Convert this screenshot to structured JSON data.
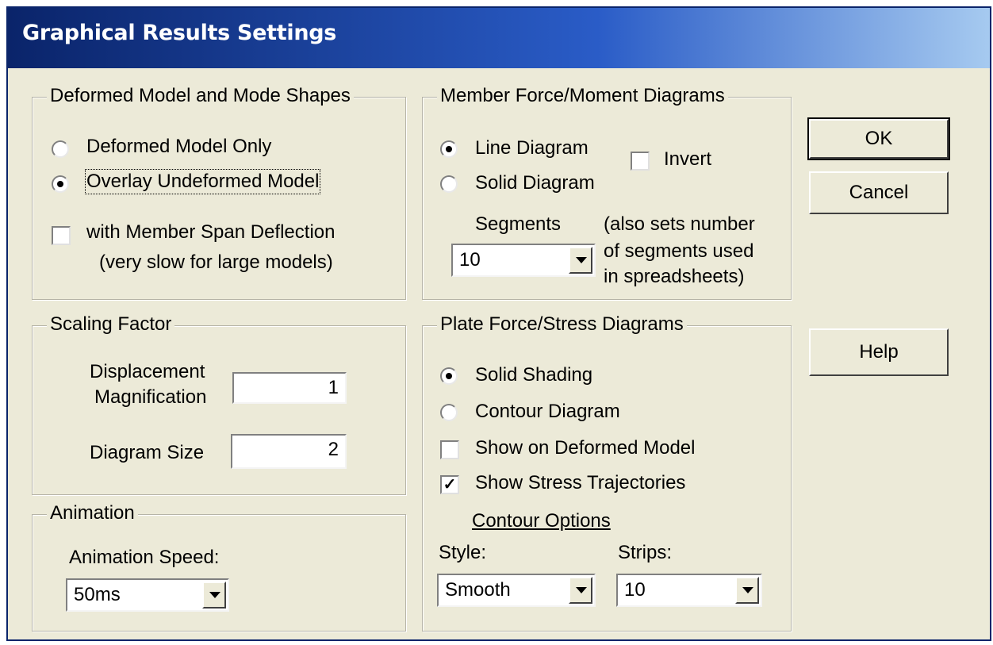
{
  "window": {
    "title": "Graphical Results Settings"
  },
  "deformed": {
    "legend": "Deformed Model and Mode Shapes",
    "option1": "Deformed Model Only",
    "option2": "Overlay Undeformed Model",
    "selected": "Overlay Undeformed Model",
    "span_check_label": "with Member Span Deflection",
    "span_check_note": "(very slow for large models)",
    "span_checked": false
  },
  "member": {
    "legend": "Member Force/Moment Diagrams",
    "option1": "Line Diagram",
    "option2": "Solid Diagram",
    "selected": "Line Diagram",
    "invert_label": "Invert",
    "invert_checked": false,
    "segments_label": "Segments",
    "segments_value": "10",
    "note_line1": "(also sets number",
    "note_line2": "of segments used",
    "note_line3": "in spreadsheets)"
  },
  "scaling": {
    "legend": "Scaling Factor",
    "displacement_label_1": "Displacement",
    "displacement_label_2": "Magnification",
    "displacement_value": "1",
    "diagram_size_label": "Diagram Size",
    "diagram_size_value": "2"
  },
  "plate": {
    "legend": "Plate Force/Stress Diagrams",
    "option1": "Solid Shading",
    "option2": "Contour Diagram",
    "selected": "Solid Shading",
    "show_deformed_label": "Show on Deformed Model",
    "show_deformed_checked": false,
    "show_trajectories_label": "Show Stress Trajectories",
    "show_trajectories_checked": true,
    "contour_options_label": "Contour Options",
    "style_label": "Style:",
    "style_value": "Smooth",
    "strips_label": "Strips:",
    "strips_value": "10"
  },
  "animation": {
    "legend": "Animation",
    "speed_label": "Animation Speed:",
    "speed_value": "50ms"
  },
  "buttons": {
    "ok": "OK",
    "cancel": "Cancel",
    "help": "Help"
  }
}
